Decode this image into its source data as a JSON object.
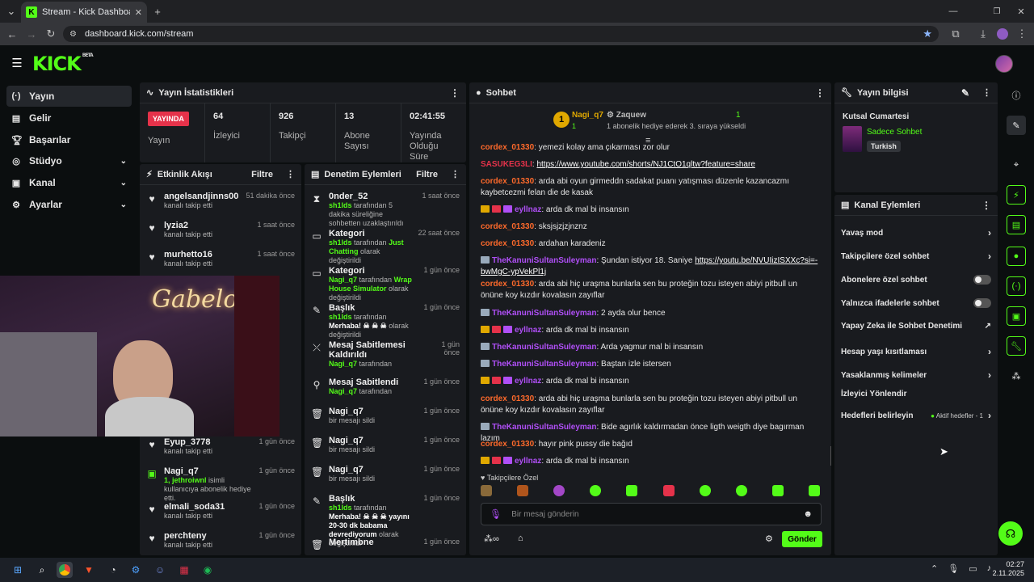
{
  "browser": {
    "tab_title": "Stream - Kick Dashboard",
    "url": "dashboard.kick.com/stream"
  },
  "brand": {
    "logo": "KICK",
    "beta": "BETA",
    "accent": "#53fc18"
  },
  "nav": [
    {
      "label": "Yayın"
    },
    {
      "label": "Gelir"
    },
    {
      "label": "Başarılar"
    },
    {
      "label": "Stüdyo"
    },
    {
      "label": "Kanal"
    },
    {
      "label": "Ayarlar"
    }
  ],
  "stats": {
    "title": "Yayın İstatistikleri",
    "live": "YAYINDA",
    "live_label": "Yayın",
    "items": [
      {
        "v": "64",
        "l": "İzleyici"
      },
      {
        "v": "926",
        "l": "Takipçi"
      },
      {
        "v": "13",
        "l": "Abone Sayısı"
      },
      {
        "v": "02:41:55",
        "l": "Yayında Olduğu Süre"
      }
    ]
  },
  "activity": {
    "title": "Etkinlik Akışı",
    "filter": "Filtre",
    "items": [
      {
        "n": "angelsandjinns00",
        "s": "kanalı takip etti",
        "t": "51 dakika önce"
      },
      {
        "n": "lyzia2",
        "s": "kanalı takip etti",
        "t": "1 saat önce"
      },
      {
        "n": "murhetto16",
        "s": "kanalı takip etti",
        "t": "1 saat önce"
      },
      {
        "n": "Eyup_3778",
        "s": "kanalı takip etti",
        "t": "1 gün önce"
      },
      {
        "n": "Nagi_q7",
        "s1": "1, jethroiwnl",
        "s2": " isimli kullanıcıya abonelik hediye etti.",
        "t": "1 gün önce"
      },
      {
        "n": "elmali_soda31",
        "s": "kanalı takip etti",
        "t": "1 gün önce"
      },
      {
        "n": "perchteny",
        "s": "kanalı takip etti",
        "t": "1 gün önce"
      }
    ]
  },
  "moderation": {
    "title": "Denetim Eylemleri",
    "filter": "Filtre",
    "items": [
      {
        "n": "0nder_52",
        "a": "sh1lds",
        "b": " tarafından 5 dakika süreliğine sohbetten uzaklaştırıldı",
        "t": "1 saat önce"
      },
      {
        "n": "Kategori",
        "a": "sh1lds",
        "b": " tarafından ",
        "c": "Just Chatting",
        "d": " olarak değiştirildi",
        "t": "22 saat önce"
      },
      {
        "n": "Kategori",
        "a": "Nagi_q7",
        "b": " tarafından ",
        "c": "Wrap House Simulator",
        "d": " olarak değiştirildi",
        "t": "1 gün önce"
      },
      {
        "n": "Başlık",
        "a": "sh1lds",
        "b": " tarafından ",
        "c": "Merhaba! ☠ ☠ ☠",
        "d": " olarak değiştirildi",
        "t": "1 gün önce"
      },
      {
        "n": "Mesaj Sabitlemesi Kaldırıldı",
        "a": "Nagi_q7",
        "b": " tarafından",
        "t": "1 gün önce"
      },
      {
        "n": "Mesaj Sabitlendi",
        "a": "Nagi_q7",
        "b": " tarafından",
        "t": "1 gün önce"
      },
      {
        "n": "Nagi_q7",
        "b": "bir mesajı sildi",
        "t": "1 gün önce"
      },
      {
        "n": "Nagi_q7",
        "b": "bir mesajı sildi",
        "t": "1 gün önce"
      },
      {
        "n": "Nagi_q7",
        "b": "bir mesajı sildi",
        "t": "1 gün önce"
      },
      {
        "n": "Başlık",
        "a": "sh1lds",
        "b": " tarafından ",
        "c": "Merhaba! ☠ ☠ ☠ yayını 20-30 dk babama devrediyorum",
        "d": " olarak değiştirildi",
        "t": "1 gün önce"
      },
      {
        "n": "Mertimbne",
        "t": "1 gün önce"
      }
    ]
  },
  "chat": {
    "title": "Sohbet",
    "pinned": {
      "rank": "1",
      "user": "Nagi_q7",
      "user_count": "1",
      "gifter": "Zaquew",
      "gift_text": "1 abonelik hediye ederek 3. sıraya yükseldi",
      "gift_count": "1"
    },
    "messages": [
      {
        "u": "cordex_01330",
        "c": "or",
        "m": ": yemezi kolay ama çıkarması zor olur"
      },
      {
        "u": "SASUKEG3LI",
        "c": "red",
        "m": ": ",
        "link": "https://www.youtube.com/shorts/NJ1CtO1qltw?feature=share"
      },
      {
        "u": "cordex_01330",
        "c": "or",
        "m": ": arda abi oyun girmeddn sadakat puanı yatışması düzenle kazancazmı kaybetcezmi felan die de kasak"
      },
      {
        "u": "eyllnaz",
        "c": "pu",
        "m": ": arda dk mal bi insansın",
        "badges": true
      },
      {
        "u": "cordex_01330",
        "c": "or",
        "m": ": sksjsjzjzjnznz"
      },
      {
        "u": "cordex_01330",
        "c": "or",
        "m": ": ardahan karadeniz"
      },
      {
        "u": "TheKanuniSultanSuleyman",
        "c": "pu",
        "m": ": Şundan istiyor 18. Saniye ",
        "link": "https://youtu.be/NVUIizISXXc?si=-bwMgC-ypVekPl1j",
        "wing": true
      },
      {
        "u": "cordex_01330",
        "c": "or",
        "m": ": arda abi hiç uraşma bunlarla sen bu proteğin tozu isteyen abiyi pitbull un önüne koy kızdır kovalasın zayıflar"
      },
      {
        "u": "TheKanuniSultanSuleyman",
        "c": "pu",
        "m": ": 2 ayda olur bence",
        "wing": true
      },
      {
        "u": "eyllnaz",
        "c": "pu",
        "m": ": arda dk mal bi insansın",
        "badges": true
      },
      {
        "u": "TheKanuniSultanSuleyman",
        "c": "pu",
        "m": ": Arda yagmur mal bi insansın",
        "wing": true
      },
      {
        "u": "TheKanuniSultanSuleyman",
        "c": "pu",
        "m": ": Baştan izle istersen",
        "wing": true
      },
      {
        "u": "eyllnaz",
        "c": "pu",
        "m": ": arda dk mal bi insansın",
        "badges": true
      },
      {
        "u": "cordex_01330",
        "c": "or",
        "m": ": arda abi hiç uraşma bunlarla sen bu proteğin tozu isteyen abiyi pitbull un önüne koy kızdır kovalasın zayıflar"
      },
      {
        "u": "TheKanuniSultanSuleyman",
        "c": "pu",
        "m": ": Bide agırlık kaldırmadan önce ligth weigth diye bagırman lazım",
        "wing": true
      },
      {
        "u": "cordex_01330",
        "c": "or",
        "m": ": hayır pink pussy die bağıd"
      },
      {
        "u": "eyllnaz",
        "c": "pu",
        "m": ": arda dk mal bi insansın",
        "badges": true
      }
    ],
    "emote_section": "Takipçilere Özel",
    "input_placeholder": "Bir mesaj gönderin",
    "send": "Gönder"
  },
  "stream_info": {
    "title": "Yayın bilgisi",
    "stream_title": "Kutsal Cumartesi",
    "category": "Sadece Sohbet",
    "language": "Turkish"
  },
  "channel_actions": {
    "title": "Kanal Eylemleri",
    "items": [
      {
        "label": "Yavaş mod",
        "kind": "chevron"
      },
      {
        "label": "Takipçilere özel sohbet",
        "kind": "chevron"
      },
      {
        "label": "Abonelere özel sohbet",
        "kind": "toggle"
      },
      {
        "label": "Yalnızca ifadelerle sohbet",
        "kind": "toggle"
      },
      {
        "label": "Yapay Zeka ile Sohbet Denetimi",
        "kind": "ext"
      },
      {
        "label": "Hesap yaşı kısıtlaması",
        "kind": "chevron"
      },
      {
        "label": "Yasaklanmış kelimeler",
        "kind": "chevron"
      },
      {
        "label": "İzleyici Yönlendir",
        "kind": "none"
      },
      {
        "label": "Hedefleri belirleyin",
        "kind": "goal",
        "extra": "Aktif hedefler - 1"
      }
    ]
  },
  "webcam": {
    "neon_text": "Gabelo"
  },
  "taskbar": {
    "time": "02:27",
    "date": "2.11.2025"
  }
}
